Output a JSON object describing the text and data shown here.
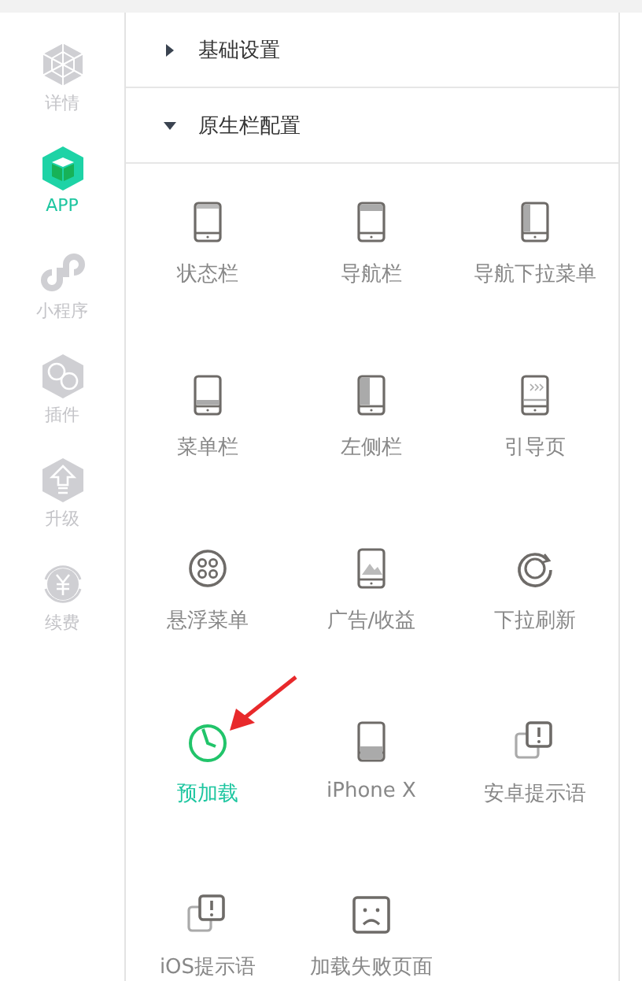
{
  "sidebar": {
    "items": [
      {
        "label": "详情",
        "kind": "web",
        "selected": false
      },
      {
        "label": "APP",
        "kind": "app",
        "selected": true
      },
      {
        "label": "小程序",
        "kind": "mini",
        "selected": false
      },
      {
        "label": "插件",
        "kind": "plugin",
        "selected": false
      },
      {
        "label": "升级",
        "kind": "upgrade",
        "selected": false
      },
      {
        "label": "续费",
        "kind": "renew",
        "selected": false
      }
    ]
  },
  "sections": [
    {
      "title": "基础设置",
      "expanded": false
    },
    {
      "title": "原生栏配置",
      "expanded": true,
      "items": [
        {
          "label": "状态栏",
          "kind": "status",
          "selected": false
        },
        {
          "label": "导航栏",
          "kind": "nav",
          "selected": false
        },
        {
          "label": "导航下拉菜单",
          "kind": "navmenu",
          "selected": false
        },
        {
          "label": "菜单栏",
          "kind": "menubar",
          "selected": false
        },
        {
          "label": "左侧栏",
          "kind": "left",
          "selected": false
        },
        {
          "label": "引导页",
          "kind": "guide",
          "selected": false
        },
        {
          "label": "悬浮菜单",
          "kind": "float",
          "selected": false
        },
        {
          "label": "广告/收益",
          "kind": "ad",
          "selected": false
        },
        {
          "label": "下拉刷新",
          "kind": "refresh",
          "selected": false
        },
        {
          "label": "预加载",
          "kind": "preload",
          "selected": true
        },
        {
          "label": "iPhone X",
          "kind": "iphonex",
          "selected": false
        },
        {
          "label": "安卓提示语",
          "kind": "tip",
          "selected": false
        },
        {
          "label": "iOS提示语",
          "kind": "tip",
          "selected": false
        },
        {
          "label": "加载失败页面",
          "kind": "fail",
          "selected": false
        }
      ]
    }
  ]
}
